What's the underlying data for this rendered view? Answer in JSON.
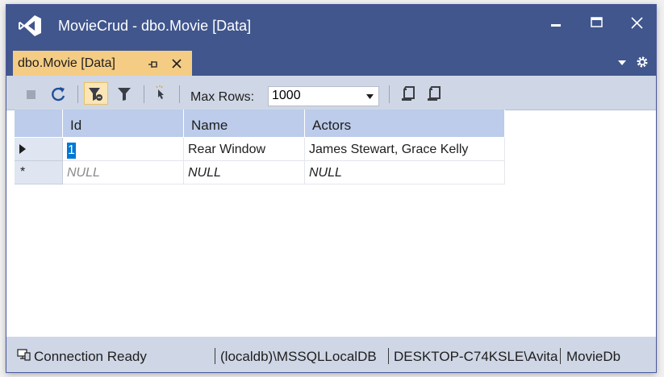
{
  "window": {
    "title": "MovieCrud - dbo.Movie [Data]",
    "colors": {
      "titlebar": "#40568d",
      "tab_active": "#f5cc84",
      "toolbar": "#cfd6e5",
      "grid_header": "#bcccea",
      "selection": "#0078d7"
    }
  },
  "tab": {
    "label": "dbo.Movie [Data]",
    "icons": [
      "pin-icon",
      "close-icon",
      "chevron-down-icon",
      "gear-icon"
    ]
  },
  "toolbar": {
    "max_rows_label": "Max Rows:",
    "max_rows_value": "1000",
    "icons": [
      "stop-icon",
      "refresh-icon",
      "filter-sort-icon",
      "filter-icon",
      "pointer-icon",
      "script-icon",
      "script-execute-icon"
    ]
  },
  "grid": {
    "columns": [
      "Id",
      "Name",
      "Actors"
    ],
    "rows": [
      {
        "indicator": "current",
        "id": "1",
        "name": "Rear Window",
        "actors": "James Stewart, Grace Kelly"
      },
      {
        "indicator": "*",
        "id": "NULL",
        "name": "NULL",
        "actors": "NULL"
      }
    ]
  },
  "status": {
    "connection": "Connection Ready",
    "server": "(localdb)\\MSSQLLocalDB",
    "user": "DESKTOP-C74KSLE\\Avita",
    "database": "MovieDb"
  }
}
